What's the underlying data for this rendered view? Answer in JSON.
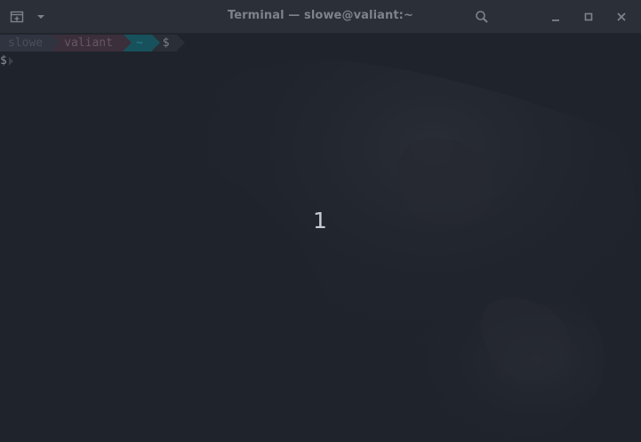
{
  "window": {
    "title": "Terminal — slowe@valiant:~"
  },
  "titlebar_icons": {
    "new_tab": "new-tab-icon",
    "menu": "chevron-down-icon",
    "search": "search-icon",
    "minimize": "minimize-icon",
    "maximize": "maximize-icon",
    "close": "close-icon"
  },
  "prompt": {
    "user": "slowe",
    "host": "valiant",
    "dir": "~",
    "symbol": "$"
  },
  "second_line": {
    "symbol": "$"
  },
  "overlay": {
    "number": "1"
  },
  "colors": {
    "background": "#1f232b",
    "titlebar": "#2b2f37",
    "prompt_user_bg": "#2f3440",
    "prompt_host_bg": "#3a2f3b",
    "prompt_dir_bg": "#17525c"
  }
}
